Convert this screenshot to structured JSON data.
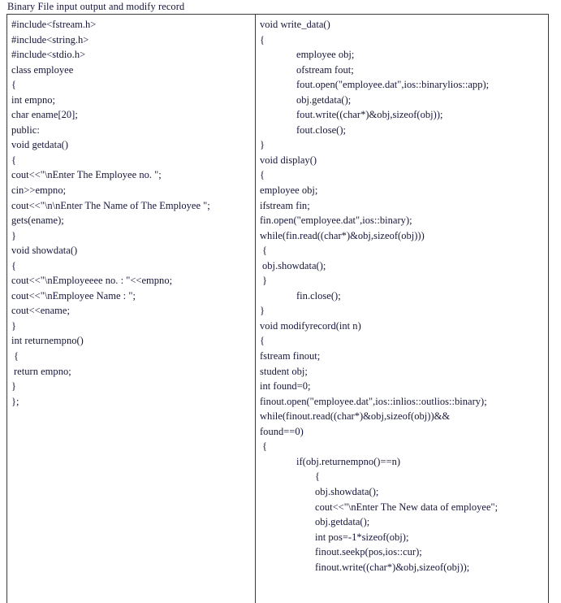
{
  "document": {
    "title": "Binary File input output and modify record"
  },
  "table": {
    "left_column": {
      "name": "class-definition-column",
      "lines": [
        {
          "text": "#include<fstream.h>",
          "indent": 0,
          "justify": false
        },
        {
          "text": "#include<string.h>",
          "indent": 0,
          "justify": false
        },
        {
          "text": "#include<stdio.h>",
          "indent": 0,
          "justify": false
        },
        {
          "text": "class employee",
          "indent": 0,
          "justify": false
        },
        {
          "text": "{",
          "indent": 0,
          "justify": false
        },
        {
          "text": "int empno;",
          "indent": 0,
          "justify": false
        },
        {
          "text": "char ename[20];",
          "indent": 0,
          "justify": false
        },
        {
          "text": "public:",
          "indent": 0,
          "justify": false
        },
        {
          "text": "void getdata()",
          "indent": 0,
          "justify": false
        },
        {
          "text": "{",
          "indent": 0,
          "justify": false
        },
        {
          "text": "cout<<\"\\nEnter The Employee no. \";",
          "indent": 0,
          "justify": false
        },
        {
          "text": "cin>>empno;",
          "indent": 0,
          "justify": false
        },
        {
          "text": "cout<<\"\\n\\nEnter The Name of The Employee \";",
          "indent": 0,
          "justify": true
        },
        {
          "text": "gets(ename);",
          "indent": 0,
          "justify": false
        },
        {
          "text": "}",
          "indent": 0,
          "justify": false
        },
        {
          "text": "void showdata()",
          "indent": 0,
          "justify": false
        },
        {
          "text": "{",
          "indent": 0,
          "justify": false
        },
        {
          "text": "cout<<\"\\nEmployeeee no. : \"<<empno;",
          "indent": 0,
          "justify": false
        },
        {
          "text": "cout<<\"\\nEmployee Name : \";",
          "indent": 0,
          "justify": false
        },
        {
          "text": "cout<<ename;",
          "indent": 0,
          "justify": false
        },
        {
          "text": "}",
          "indent": 0,
          "justify": false
        },
        {
          "text": "int returnempno()",
          "indent": 0,
          "justify": false
        },
        {
          "text": "{",
          "indent": 1,
          "justify": false
        },
        {
          "text": "return empno;",
          "indent": 1,
          "justify": false
        },
        {
          "text": "}",
          "indent": 0,
          "justify": false
        },
        {
          "text": "};",
          "indent": 0,
          "justify": false
        }
      ]
    },
    "right_column": {
      "name": "member-functions-column",
      "lines": [
        {
          "text": "void write_data()",
          "indent": 0,
          "justify": false
        },
        {
          "text": "{",
          "indent": 0,
          "justify": false
        },
        {
          "text": "employee obj;",
          "indent": 2,
          "justify": false
        },
        {
          "text": "ofstream fout;",
          "indent": 2,
          "justify": false
        },
        {
          "text": "fout.open(\"employee.dat\",ios::binarylios::app);",
          "indent": 2,
          "justify": false
        },
        {
          "text": "obj.getdata();",
          "indent": 2,
          "justify": false
        },
        {
          "text": "fout.write((char*)&obj,sizeof(obj));",
          "indent": 2,
          "justify": false
        },
        {
          "text": "fout.close();",
          "indent": 2,
          "justify": false
        },
        {
          "text": "}",
          "indent": 0,
          "justify": false
        },
        {
          "text": "void display()",
          "indent": 0,
          "justify": false
        },
        {
          "text": "{",
          "indent": 0,
          "justify": false
        },
        {
          "text": "employee obj;",
          "indent": 0,
          "justify": false
        },
        {
          "text": "ifstream fin;",
          "indent": 0,
          "justify": false
        },
        {
          "text": "fin.open(\"employee.dat\",ios::binary);",
          "indent": 0,
          "justify": false
        },
        {
          "text": "while(fin.read((char*)&obj,sizeof(obj)))",
          "indent": 0,
          "justify": false
        },
        {
          "text": "{",
          "indent": 1,
          "justify": false
        },
        {
          "text": "obj.showdata();",
          "indent": 1,
          "justify": false
        },
        {
          "text": "}",
          "indent": 1,
          "justify": false
        },
        {
          "text": "fin.close();",
          "indent": 2,
          "justify": false
        },
        {
          "text": "}",
          "indent": 0,
          "justify": false
        },
        {
          "text": "void modifyrecord(int n)",
          "indent": 0,
          "justify": false
        },
        {
          "text": "{",
          "indent": 0,
          "justify": false
        },
        {
          "text": "fstream finout;",
          "indent": 0,
          "justify": false
        },
        {
          "text": "student obj;",
          "indent": 0,
          "justify": false
        },
        {
          "text": "int found=0;",
          "indent": 0,
          "justify": false
        },
        {
          "text": "finout.open(\"employee.dat\",ios::inlios::outlios::binary);",
          "indent": 0,
          "justify": false
        },
        {
          "text": "while(finout.read((char*)&obj,sizeof(obj))&&",
          "indent": 0,
          "justify": false
        },
        {
          "text": "found==0)",
          "indent": 0,
          "justify": false
        },
        {
          "text": "{",
          "indent": 1,
          "justify": false
        },
        {
          "text": "if(obj.returnempno()==n)",
          "indent": 2,
          "justify": false
        },
        {
          "text": "{",
          "indent": 3,
          "justify": false
        },
        {
          "text": "obj.showdata();",
          "indent": 3,
          "justify": false
        },
        {
          "text": "cout<<\"\\nEnter The New data of employee\";",
          "indent": 3,
          "justify": true
        },
        {
          "text": "obj.getdata();",
          "indent": 3,
          "justify": false
        },
        {
          "text": "int pos=-1*sizeof(obj);",
          "indent": 3,
          "justify": false
        },
        {
          "text": "finout.seekp(pos,ios::cur);",
          "indent": 3,
          "justify": false
        },
        {
          "text": "finout.write((char*)&obj,sizeof(obj));",
          "indent": 3,
          "justify": false
        }
      ]
    }
  }
}
